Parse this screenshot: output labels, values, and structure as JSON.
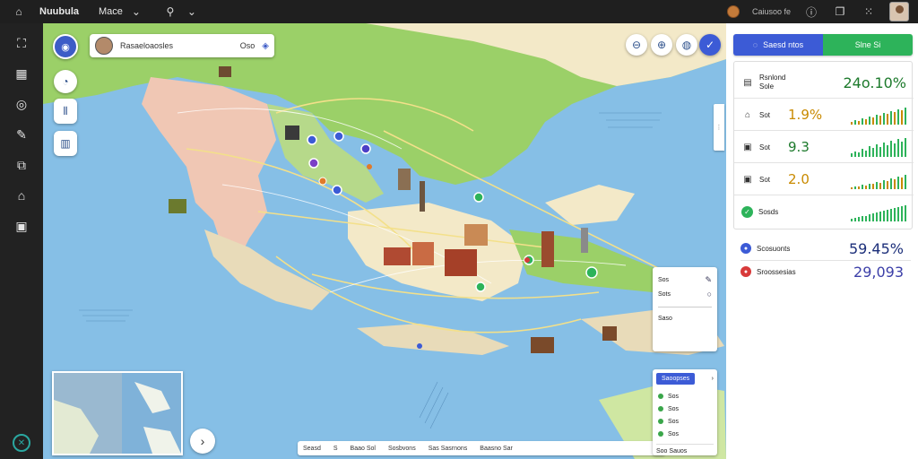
{
  "topbar": {
    "app_name": "Nuubula",
    "menu": "Mace",
    "user_label": "Caiusoo fe"
  },
  "search": {
    "placeholder": "Rasaeloaosles",
    "suffix": "Oso"
  },
  "right_panel": {
    "tabs": [
      {
        "label": "Saesd ntos"
      },
      {
        "label": "Slne Si"
      }
    ],
    "summary": {
      "title": "Rsnlond",
      "subtitle": "Sole",
      "value": "24o.10%"
    },
    "rows": [
      {
        "label": "Sot",
        "value": "1.9%",
        "color": "#c98a00"
      },
      {
        "label": "Sot",
        "value": "9.3",
        "color": "#1d7a2c"
      },
      {
        "label": "Sot",
        "value": "2.0",
        "color": "#c98a00"
      },
      {
        "label": "Sosds",
        "value": "",
        "color": "#1d7a2c"
      }
    ],
    "stats": [
      {
        "label": "Scosuonts",
        "value": "59.45%",
        "color": "#3c5bd6"
      },
      {
        "label": "Sroossesias",
        "value": "29,093",
        "color": "#d83a3a"
      }
    ]
  },
  "map_legend": {
    "items": [
      "Sos",
      "Sots",
      "Saso"
    ]
  },
  "filter_panel": {
    "tab": "Saoopses",
    "items": [
      "Sos",
      "Sos",
      "Sos",
      "Sos"
    ],
    "footer": "Soo Sauos"
  },
  "bottom_strip": {
    "items": [
      "Seasd",
      "S",
      "Baao Sol",
      "Sosbvons",
      "Sas Sasrnons",
      "Baasno Sar"
    ]
  },
  "map": {
    "land_colors": [
      "#9bd068",
      "#f0c7b4",
      "#f3e9c8",
      "#e8dbb9"
    ],
    "route_color": "#f3e08a"
  }
}
